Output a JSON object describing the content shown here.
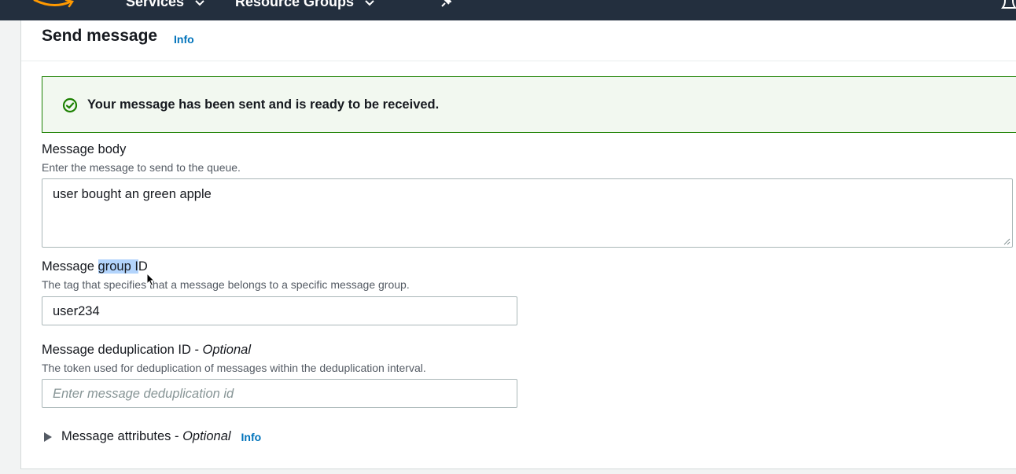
{
  "nav": {
    "services_label": "Services",
    "resource_groups_label": "Resource Groups"
  },
  "header": {
    "title": "Send message",
    "info_label": "Info"
  },
  "alert": {
    "message": "Your message has been sent and is ready to be received.",
    "icon": "success-check-icon",
    "color": "#1d8102"
  },
  "message_body": {
    "label": "Message body",
    "description": "Enter the message to send to the queue.",
    "value": "user bought an green apple"
  },
  "group_id": {
    "label_prefix": "Message ",
    "label_highlight": "group I",
    "label_suffix": "D",
    "description": "The tag that specifies that a message belongs to a specific message group.",
    "value": "user234"
  },
  "dedup_id": {
    "label": "Message deduplication ID - ",
    "optional": "Optional",
    "description": "The token used for deduplication of messages within the deduplication interval.",
    "placeholder": "Enter message deduplication id"
  },
  "attributes": {
    "label": "Message attributes - ",
    "optional": "Optional",
    "info_label": "Info"
  },
  "colors": {
    "nav_bg": "#232f3e",
    "link": "#0073bb",
    "success": "#1d8102",
    "success_bg": "#f2f8f0"
  }
}
